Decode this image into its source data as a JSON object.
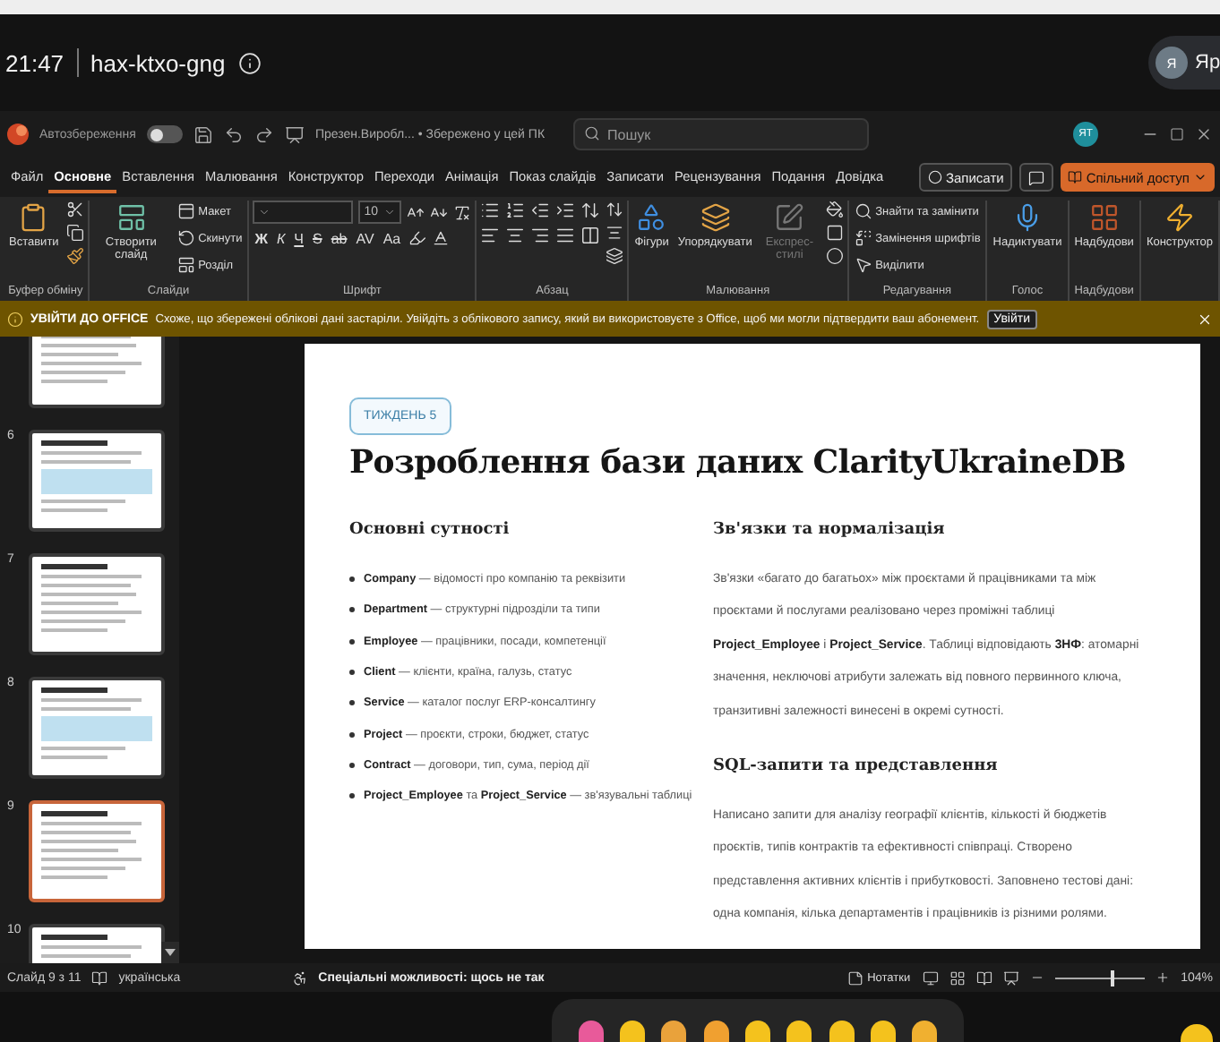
{
  "meet": {
    "time": "21:47",
    "code": "hax-ktxo-gng",
    "user_initial": "Я",
    "user_name": "Яр"
  },
  "titlebar": {
    "autosave_label": "Автозбереження",
    "autosave_on": false,
    "file": "Презен.Виробл... • Збережено у цей ПК",
    "search_placeholder": "Пошук",
    "account": "ЯТ"
  },
  "tabs": [
    {
      "label": "Файл",
      "selected": false
    },
    {
      "label": "Основне",
      "selected": true
    },
    {
      "label": "Вставлення",
      "selected": false
    },
    {
      "label": "Малювання",
      "selected": false
    },
    {
      "label": "Конструктор",
      "selected": false
    },
    {
      "label": "Переходи",
      "selected": false
    },
    {
      "label": "Анімація",
      "selected": false
    },
    {
      "label": "Показ слайдів",
      "selected": false
    },
    {
      "label": "Записати",
      "selected": false
    },
    {
      "label": "Рецензування",
      "selected": false
    },
    {
      "label": "Подання",
      "selected": false
    },
    {
      "label": "Довідка",
      "selected": false
    }
  ],
  "record_button": "Записати",
  "share_button": "Спільний доступ",
  "ribbon": [
    {
      "kind": "clipboard",
      "label": "Буфер обміну",
      "items": [
        {
          "label": "Вставити",
          "disabled": false
        }
      ]
    },
    {
      "kind": "slides",
      "label": "Слайди",
      "items": [
        {
          "label": "Створити слайд",
          "disabled": false
        },
        {
          "label": "Макет",
          "disabled": false
        },
        {
          "label": "Скинути",
          "disabled": false
        },
        {
          "label": "Розділ",
          "disabled": false
        }
      ]
    },
    {
      "kind": "font",
      "label": "Шрифт",
      "size": "10",
      "letters": [
        "Ж",
        "К",
        "Ч",
        "S",
        "ab",
        "AV",
        "Aa"
      ]
    },
    {
      "kind": "paragraph",
      "label": "Абзац"
    },
    {
      "kind": "drawing",
      "label": "Малювання",
      "items": [
        {
          "label": "Фігури",
          "disabled": false
        },
        {
          "label": "Упорядкувати",
          "disabled": false
        },
        {
          "label": "Експрес-стилі",
          "disabled": true
        }
      ]
    },
    {
      "kind": "editing",
      "label": "Редагування",
      "items": [
        {
          "label": "Знайти та замінити",
          "disabled": false
        },
        {
          "label": "Замінення шрифтів",
          "disabled": false
        },
        {
          "label": "Виділити",
          "disabled": false
        }
      ]
    },
    {
      "kind": "voice",
      "label": "Голос",
      "items": [
        {
          "label": "Надиктувати",
          "disabled": false
        }
      ]
    },
    {
      "kind": "addins",
      "label": "Надбудови",
      "items": [
        {
          "label": "Надбудови",
          "disabled": false
        }
      ]
    },
    {
      "kind": "designer",
      "items": [
        {
          "label": "Конструктор",
          "disabled": false
        }
      ]
    }
  ],
  "banner": {
    "title": "УВІЙТИ ДО OFFICE",
    "message": "Схоже, що збережені облікові дані застаріли. Увійдіть з облікового запису, який ви використовуєте з Office, щоб ми могли підтвердити ваш абонемент.",
    "button": "Увійти"
  },
  "thumbnails": [
    {
      "number": "6",
      "selected": false
    },
    {
      "number": "7",
      "selected": false
    },
    {
      "number": "8",
      "selected": false
    },
    {
      "number": "9",
      "selected": true
    },
    {
      "number": "10",
      "selected": false
    }
  ],
  "slide": {
    "badge": "ТИЖДЕНЬ 5",
    "title": "Розроблення бази даних ClarityUkraineDB",
    "left_heading": "Основні сутності",
    "entities": [
      "**Company** — відомості про компанію та реквізити",
      "**Department** — структурні підрозділи та типи",
      "**Employee** — працівники, посади, компетенції",
      "**Client** — клієнти, країна, галузь, статус",
      "**Service** — каталог послуг ERP-консалтингу",
      "**Project** — проєкти, строки, бюджет, статус",
      "**Contract** — договори, тип, сума, період дії",
      "**Project_Employee** та **Project_Service** — зв'язувальні таблиці"
    ],
    "sections": [
      {
        "heading": "Зв'язки та нормалізація",
        "text": "Зв'язки «багато до багатьох» між проєктами й працівниками та між проєктами й послугами реалізовано через проміжні таблиці **Project_Employee** і **Project_Service**. Таблиці відповідають **3НФ**: атомарні значення, неключові атрибути залежать від повного первинного ключа, транзитивні залежності винесені в окремі сутності."
      },
      {
        "heading": "SQL-запити та представлення",
        "text": "Написано запити для аналізу географії клієнтів, кількості й бюджетів проєктів, типів контрактів та ефективності співпраці. Створено представлення активних клієнтів і прибутковості. Заповнено тестові дані: одна компанія, кілька департаментів і працівників із різними ролями."
      }
    ]
  },
  "status": {
    "slide": "Слайд 9 з 11",
    "language": "українська",
    "accessibility": "Спеціальні можливості: щось не так",
    "notes": "Нотатки",
    "zoom": "104%",
    "level": 0.62
  }
}
